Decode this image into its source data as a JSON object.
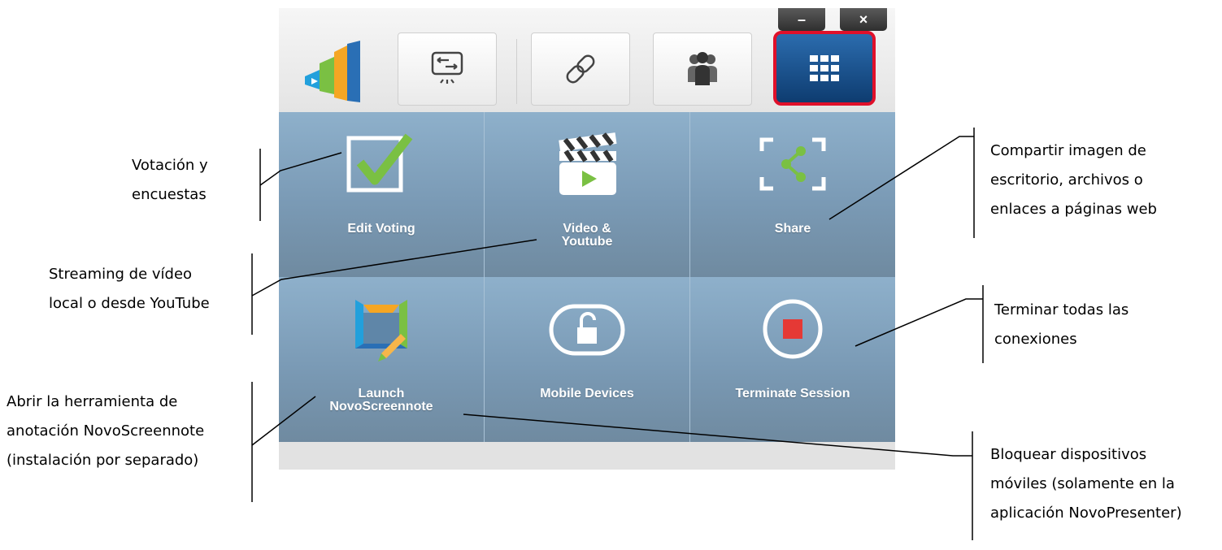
{
  "window_controls": {
    "minimize": "–",
    "close": "×"
  },
  "toolbar": {
    "buttons": [
      {
        "icon": "screen-share-icon"
      },
      {
        "icon": "link-icon"
      },
      {
        "icon": "users-icon"
      },
      {
        "icon": "apps-grid-icon",
        "active": true
      }
    ]
  },
  "tiles": [
    {
      "label": "Edit Voting",
      "icon": "checkbox-check-icon"
    },
    {
      "label": "Video &\nYoutube",
      "icon": "clapperboard-play-icon"
    },
    {
      "label": "Share",
      "icon": "share-icon"
    },
    {
      "label": "Launch\nNovoScreennote",
      "icon": "novoscreennote-icon"
    },
    {
      "label": "Mobile Devices",
      "icon": "unlock-icon"
    },
    {
      "label": "Terminate Session",
      "icon": "stop-icon"
    }
  ],
  "annotations": {
    "voting": [
      "Votación y",
      "encuestas"
    ],
    "streaming": [
      "Streaming de vídeo",
      "local o desde YouTube"
    ],
    "novoscreennote": [
      "Abrir la herramienta de",
      "anotación NovoScreennote",
      "(instalación por separado)"
    ],
    "share": [
      "Compartir imagen de",
      "escritorio, archivos o",
      "enlaces a páginas web"
    ],
    "terminate": [
      "Terminar todas las",
      "conexiones"
    ],
    "mobile": [
      "Bloquear dispositivos",
      "móviles (solamente en la",
      "aplicación NovoPresenter)"
    ]
  },
  "colors": {
    "active_border": "#e0102a",
    "active_bg": "#0e3c70",
    "tile_bg": "#7a9ab5",
    "stop_red": "#e53935",
    "check_green": "#7ac043"
  }
}
